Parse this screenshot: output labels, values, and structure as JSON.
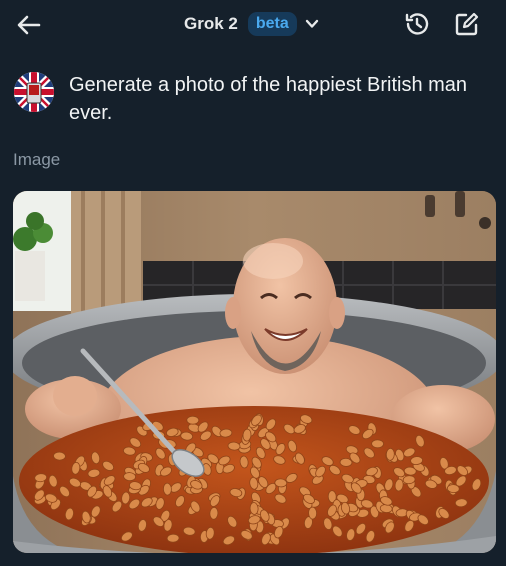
{
  "header": {
    "model_name": "Grok 2",
    "badge": "beta",
    "icons": [
      "back-arrow-icon",
      "chevron-down-icon",
      "history-icon",
      "edit-icon"
    ]
  },
  "message": {
    "avatar": "union-jack-avatar",
    "text": "Generate a photo of the happiest British man ever."
  },
  "result": {
    "label": "Image",
    "image_description": "generated image"
  },
  "colors": {
    "background": "#15202b",
    "badge_text": "#4aa9ee",
    "badge_bg": "#163a5a",
    "muted_text": "#8b98a5"
  }
}
